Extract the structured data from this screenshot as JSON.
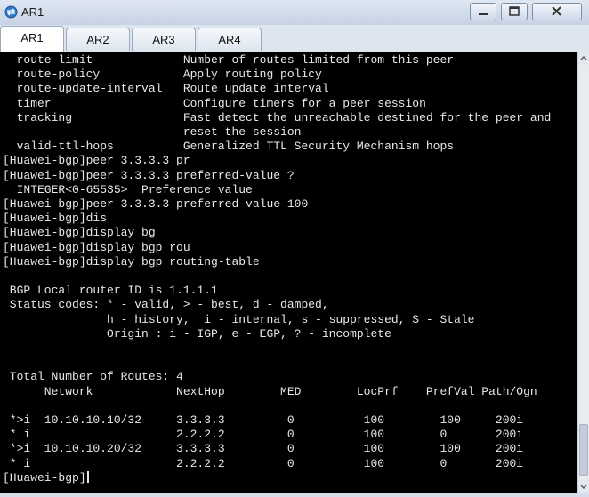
{
  "window": {
    "title": "AR1",
    "icons": {
      "app": "network-device-icon",
      "minimize": "minimize-icon",
      "maximize": "maximize-icon",
      "close": "close-icon"
    }
  },
  "tabs": [
    {
      "label": "AR1",
      "active": true
    },
    {
      "label": "AR2",
      "active": false
    },
    {
      "label": "AR3",
      "active": false
    },
    {
      "label": "AR4",
      "active": false
    }
  ],
  "terminal": {
    "colors": {
      "background": "#000000",
      "text": "#e8e8e8"
    },
    "lines": [
      "  route-limit             Number of routes limited from this peer",
      "  route-policy            Apply routing policy",
      "  route-update-interval   Route update interval",
      "  timer                   Configure timers for a peer session",
      "  tracking                Fast detect the unreachable destined for the peer and",
      "                          reset the session",
      "  valid-ttl-hops          Generalized TTL Security Mechanism hops",
      "[Huawei-bgp]peer 3.3.3.3 pr",
      "[Huawei-bgp]peer 3.3.3.3 preferred-value ?",
      "  INTEGER<0-65535>  Preference value",
      "[Huawei-bgp]peer 3.3.3.3 preferred-value 100",
      "[Huawei-bgp]dis",
      "[Huawei-bgp]display bg",
      "[Huawei-bgp]display bgp rou",
      "[Huawei-bgp]display bgp routing-table",
      "",
      " BGP Local router ID is 1.1.1.1",
      " Status codes: * - valid, > - best, d - damped,",
      "               h - history,  i - internal, s - suppressed, S - Stale",
      "               Origin : i - IGP, e - EGP, ? - incomplete",
      "",
      "",
      " Total Number of Routes: 4",
      "      Network            NextHop        MED        LocPrf    PrefVal Path/Ogn",
      "",
      " *>i  10.10.10.10/32     3.3.3.3         0          100        100     200i",
      " * i                     2.2.2.2         0          100        0       200i",
      " *>i  10.10.10.20/32     3.3.3.3         0          100        100     200i",
      " * i                     2.2.2.2         0          100        0       200i"
    ],
    "prompt": "[Huawei-bgp]"
  }
}
